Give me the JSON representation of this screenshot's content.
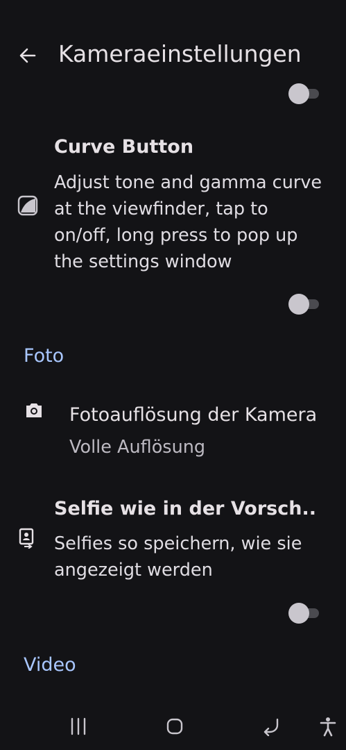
{
  "header": {
    "title": "Kameraeinstellungen",
    "back_icon": "arrow-left-icon"
  },
  "settings": {
    "top_toggle_on": false,
    "curve_button": {
      "title": "Curve Button",
      "description": "Adjust tone and gamma curve at the viewfinder, tap to on/off, long press to pop up the settings window",
      "icon": "curve-icon",
      "toggle_on": false
    },
    "section_foto": "Foto",
    "photo_resolution": {
      "title": "Fotoauflösung der Kamera",
      "value": "Volle Auflösung",
      "icon": "camera-icon"
    },
    "selfie_preview": {
      "title": "Selfie wie in der Vorsch..",
      "description": "Selfies so speichern, wie sie angezeigt werden",
      "icon": "portrait-icon",
      "toggle_on": false
    },
    "section_video": "Video"
  },
  "navbar": {
    "recents_icon": "recents-icon",
    "home_icon": "home-icon",
    "back_icon": "nav-back-icon",
    "accessibility_icon": "accessibility-icon"
  },
  "colors": {
    "background": "#131316",
    "accent": "#a9c7ff",
    "toggle_thumb": "#c9c6cd",
    "toggle_track": "#4a4a4f"
  }
}
